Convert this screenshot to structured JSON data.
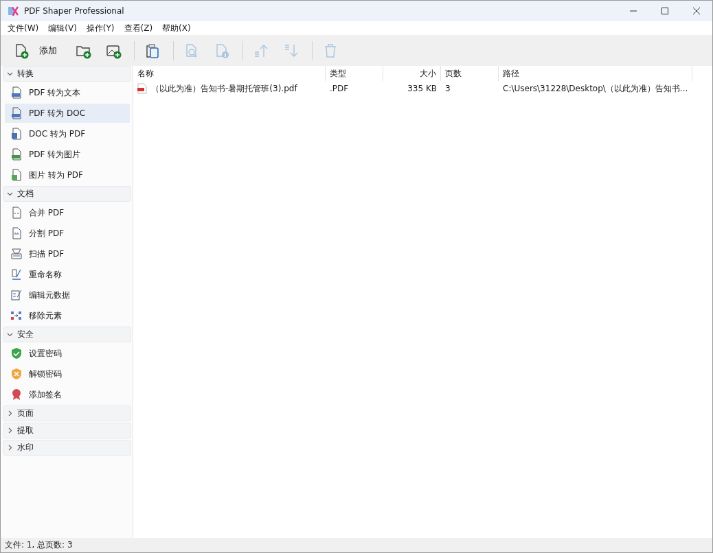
{
  "window": {
    "title": "PDF Shaper Professional"
  },
  "menu": [
    "文件(W)",
    "编辑(V)",
    "操作(Y)",
    "查看(Z)",
    "帮助(X)"
  ],
  "toolbar": [
    {
      "kind": "add-file",
      "label": "添加",
      "disabled": false
    },
    {
      "kind": "add-folder",
      "disabled": false
    },
    {
      "kind": "add-image",
      "disabled": false
    },
    {
      "kind": "clipboard",
      "disabled": false
    },
    {
      "kind": "preview",
      "disabled": true
    },
    {
      "kind": "info",
      "disabled": true
    },
    {
      "kind": "up",
      "disabled": true
    },
    {
      "kind": "down",
      "disabled": true
    },
    {
      "kind": "delete",
      "disabled": true
    }
  ],
  "sidebar": [
    {
      "title": "转换",
      "expanded": true,
      "items": [
        {
          "kind": "txt",
          "label": "PDF 转为文本",
          "selected": false
        },
        {
          "kind": "doc",
          "label": "PDF 转为 DOC",
          "selected": true
        },
        {
          "kind": "word",
          "label": "DOC 转为 PDF",
          "selected": false
        },
        {
          "kind": "jpg",
          "label": "PDF 转为图片",
          "selected": false
        },
        {
          "kind": "picture",
          "label": "图片 转为 PDF",
          "selected": false
        }
      ]
    },
    {
      "title": "文档",
      "expanded": true,
      "items": [
        {
          "kind": "merge",
          "label": "合并 PDF",
          "selected": false
        },
        {
          "kind": "split",
          "label": "分割 PDF",
          "selected": false
        },
        {
          "kind": "scan",
          "label": "扫描 PDF",
          "selected": false
        },
        {
          "kind": "rename",
          "label": "重命名称",
          "selected": false
        },
        {
          "kind": "meta",
          "label": "编辑元数据",
          "selected": false
        },
        {
          "kind": "remove",
          "label": "移除元素",
          "selected": false
        }
      ]
    },
    {
      "title": "安全",
      "expanded": true,
      "items": [
        {
          "kind": "shield-ok",
          "label": "设置密码",
          "selected": false
        },
        {
          "kind": "shield-x",
          "label": "解锁密码",
          "selected": false
        },
        {
          "kind": "seal",
          "label": "添加签名",
          "selected": false
        }
      ]
    },
    {
      "title": "页面",
      "expanded": false
    },
    {
      "title": "提取",
      "expanded": false
    },
    {
      "title": "水印",
      "expanded": false
    }
  ],
  "table": {
    "columns": [
      "名称",
      "类型",
      "大小",
      "页数",
      "路径"
    ],
    "rows": [
      {
        "name": "（以此为准）告知书-暑期托管班(3).pdf",
        "type": ".PDF",
        "size": "335 KB",
        "pages": "3",
        "path": "C:\\Users\\31228\\Desktop\\（以此为准）告知书..."
      }
    ]
  },
  "status_bar": "文件: 1, 总页数: 3"
}
